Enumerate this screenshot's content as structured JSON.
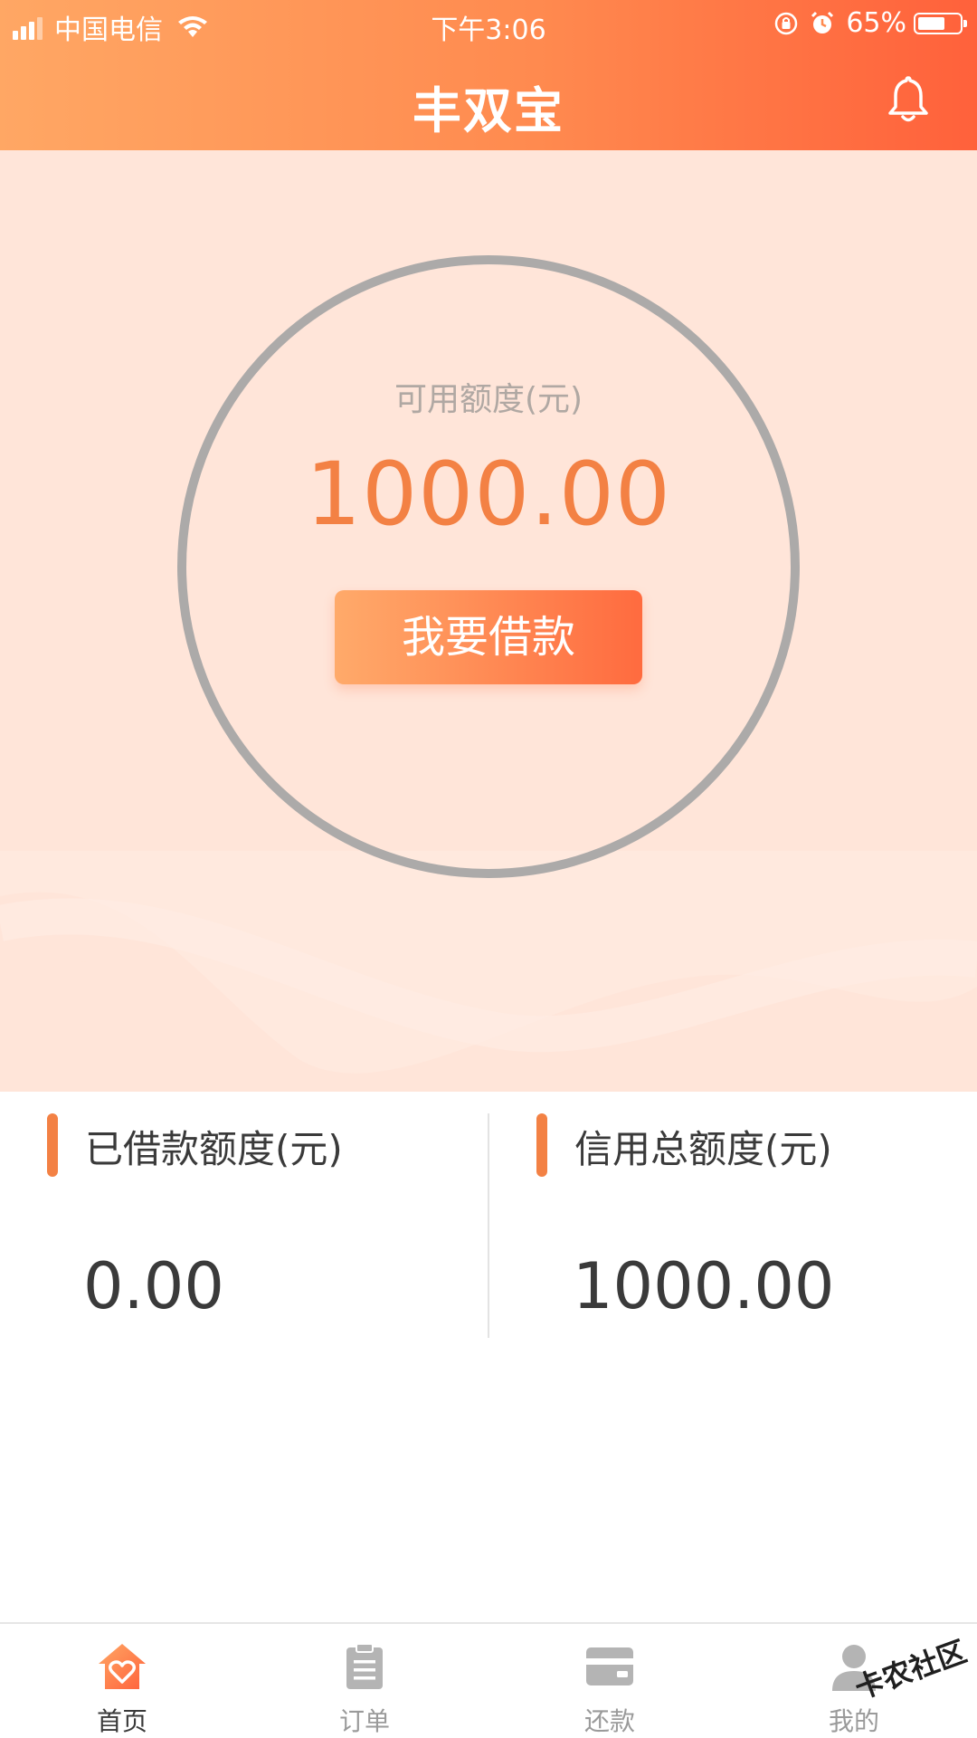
{
  "status_bar": {
    "carrier": "中国电信",
    "time": "下午3:06",
    "battery_percent": "65%",
    "battery_level": 0.65
  },
  "header": {
    "title": "丰双宝",
    "icon": "bell-icon"
  },
  "credit": {
    "available_label": "可用额度(元)",
    "available_amount": "1000.00",
    "borrow_button": "我要借款"
  },
  "stats": {
    "borrowed_label": "已借款额度(元)",
    "borrowed_value": "0.00",
    "total_label": "信用总额度(元)",
    "total_value": "1000.00"
  },
  "tabbar": {
    "items": [
      {
        "label": "首页",
        "icon": "home-heart-icon",
        "active": true
      },
      {
        "label": "订单",
        "icon": "clipboard-icon",
        "active": false
      },
      {
        "label": "还款",
        "icon": "card-icon",
        "active": false
      },
      {
        "label": "我的",
        "icon": "user-icon",
        "active": false
      }
    ]
  },
  "colors": {
    "accent": "#f38144",
    "header_start": "#ffa764",
    "header_end": "#ff613b",
    "hero_bg": "#ffe5d9",
    "ring": "#acaaa9"
  },
  "watermark": {
    "text": "卡农社区"
  }
}
